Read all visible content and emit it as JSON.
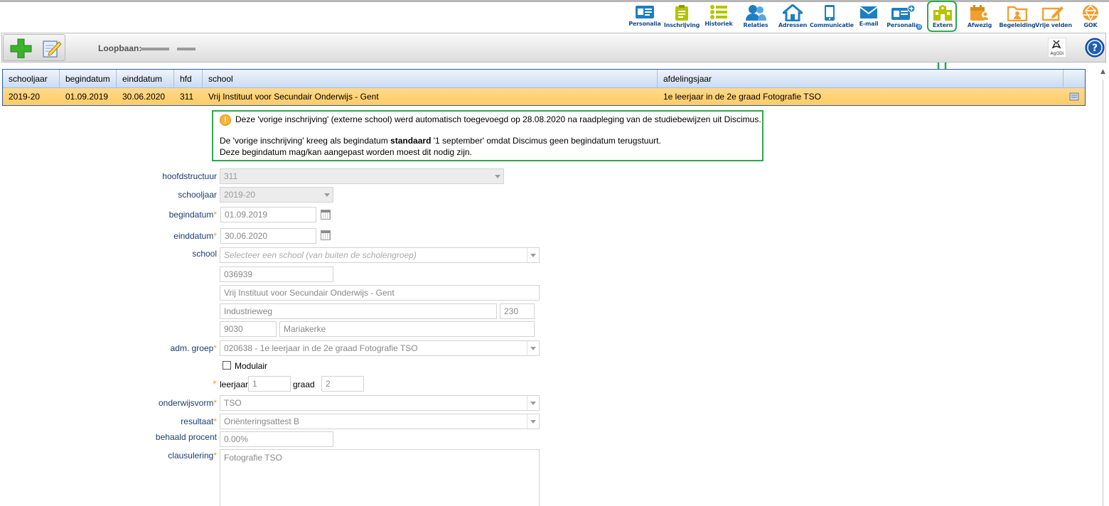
{
  "nav": [
    {
      "label": "Personalia",
      "icon": "id-card-icon",
      "color": "#1c7fc4"
    },
    {
      "label": "Inschrijving",
      "icon": "clipboard-icon",
      "color": "#b5c400"
    },
    {
      "label": "Historiek",
      "icon": "list-icon",
      "color": "#b5c400"
    },
    {
      "label": "Relaties",
      "icon": "people-icon",
      "color": "#1c7fc4"
    },
    {
      "label": "Adressen",
      "icon": "house-icon",
      "color": "#1c7fc4"
    },
    {
      "label": "Communicatie",
      "icon": "phone-icon",
      "color": "#1c7fc4"
    },
    {
      "label": "E-mail",
      "icon": "envelope-icon",
      "color": "#1c7fc4"
    },
    {
      "label": "Personalia",
      "icon": "id-card-plus-icon",
      "color": "#1c7fc4"
    },
    {
      "label": "Extern",
      "icon": "school-building-icon",
      "color": "#b5c400"
    },
    {
      "label": "Afwezig",
      "icon": "calendar-person-icon",
      "color": "#f0a030"
    },
    {
      "label": "Begeleiding",
      "icon": "folder-person-icon",
      "color": "#f0a030"
    },
    {
      "label": "Vrije velden",
      "icon": "edit-pencil-icon",
      "color": "#f0a030"
    },
    {
      "label": "GOK",
      "icon": "network-icon",
      "color": "#f0a030"
    }
  ],
  "toolbar": {
    "loopbaan_label": "Loopbaan:"
  },
  "grid": {
    "columns": [
      "schooljaar",
      "begindatum",
      "einddatum",
      "hfd",
      "school",
      "afdelingsjaar"
    ],
    "row": [
      "2019-20",
      "01.09.2019",
      "30.06.2020",
      "311",
      "Vrij Instituut voor Secundair Onderwijs - Gent",
      "1e leerjaar in de 2e graad Fotografie TSO"
    ]
  },
  "info": {
    "line1": "Deze 'vorige inschrijving' (externe school) werd automatisch toegevoegd op 28.08.2020 na raadpleging van de studiebewijzen uit Discimus.",
    "line2_pre": "De 'vorige inschrijving' kreeg als begindatum ",
    "line2_bold": "standaard",
    "line2_post": " '1 september' omdat Discimus geen begindatum terugstuurt.",
    "line3": "Deze begindatum mag/kan aangepast worden moest dit nodig zijn."
  },
  "form": {
    "hoofdstructuur": {
      "label": "hoofdstructuur",
      "value": "311"
    },
    "schooljaar": {
      "label": "schooljaar",
      "value": "2019-20"
    },
    "begindatum": {
      "label": "begindatum",
      "value": "01.09.2019"
    },
    "einddatum": {
      "label": "einddatum",
      "value": "30.06.2020"
    },
    "school": {
      "label": "school",
      "placeholder": "Selecteer een school (van buiten de scholengroep)",
      "code": "036939",
      "name": "Vrij Instituut voor Secundair Onderwijs - Gent",
      "street": "Industrieweg",
      "number": "230",
      "postcode": "9030",
      "city": "Mariakerke"
    },
    "adm_groep": {
      "label": "adm. groep",
      "value": "020638 - 1e leerjaar in de 2e graad Fotografie TSO"
    },
    "modulair": {
      "label": "Modulair"
    },
    "leerjaar": {
      "label": "leerjaar",
      "value": "1"
    },
    "graad": {
      "label": "graad",
      "value": "2"
    },
    "onderwijsvorm": {
      "label": "onderwijsvorm",
      "value": "TSO"
    },
    "resultaat": {
      "label": "resultaat",
      "value": "Oriënteringsattest B"
    },
    "behaald_procent": {
      "label": "behaald procent",
      "value": "0.00%"
    },
    "clausulering": {
      "label": "clausulering",
      "value": "Fotografie TSO"
    },
    "required_mark": "*"
  }
}
